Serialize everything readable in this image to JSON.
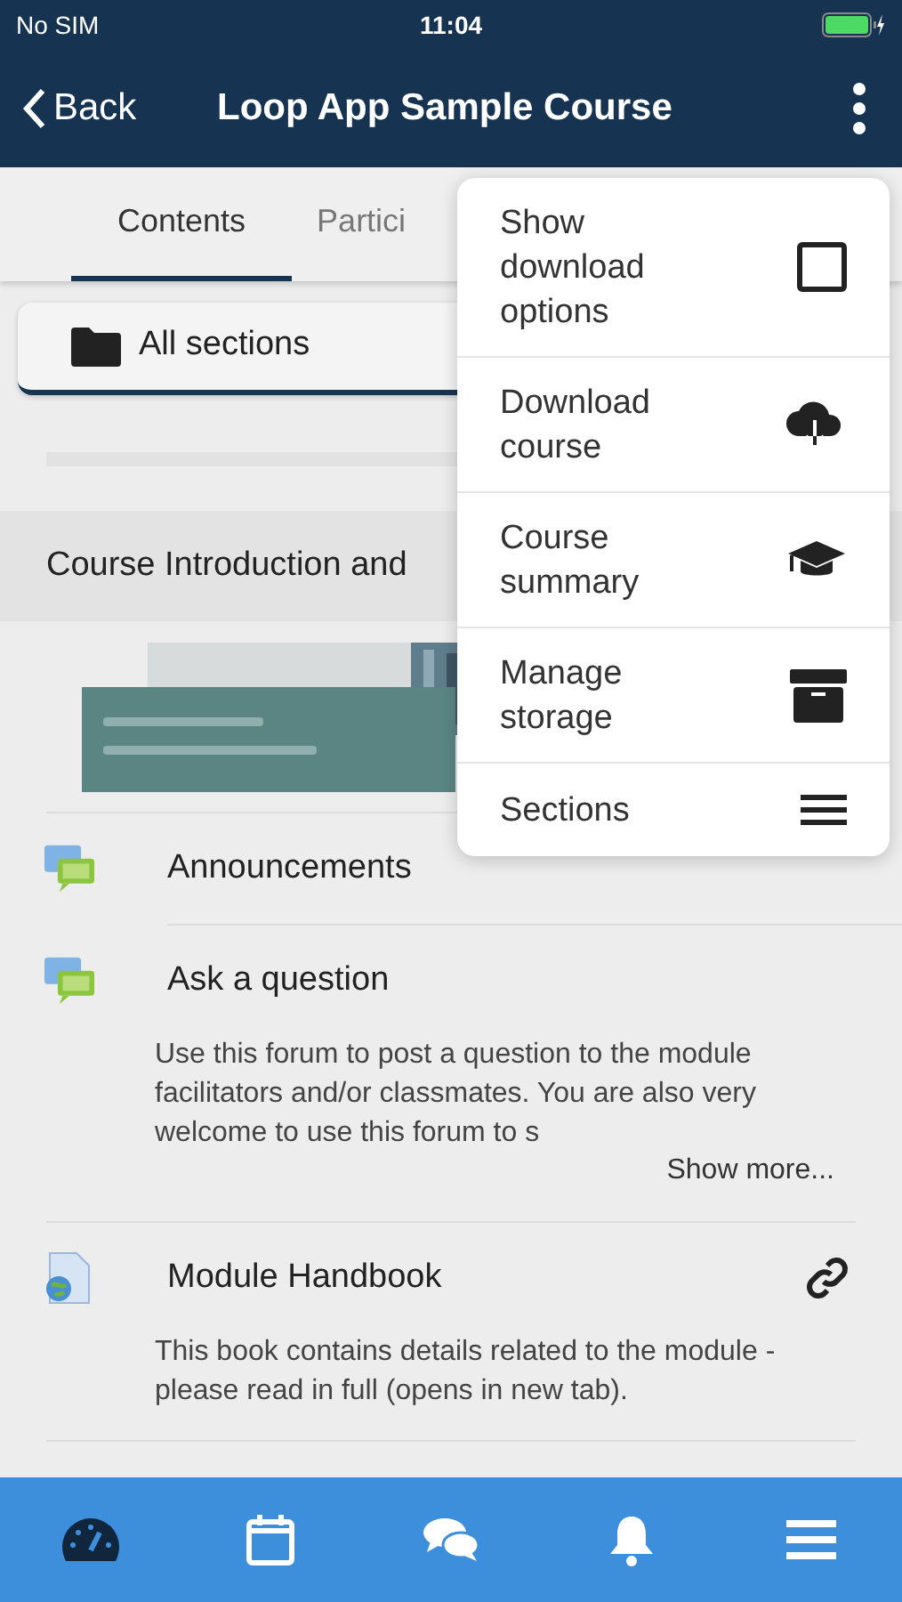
{
  "status_bar": {
    "carrier": "No SIM",
    "time": "11:04"
  },
  "nav_bar": {
    "back": "Back",
    "title": "Loop App Sample Course"
  },
  "tabs": [
    {
      "label": "Contents",
      "selected": true
    },
    {
      "label": "Partici",
      "selected": false
    }
  ],
  "section_selector": {
    "label": "All sections"
  },
  "section": {
    "title": "Course Introduction and"
  },
  "activities": [
    {
      "kind": "forum",
      "title": "Announcements"
    },
    {
      "kind": "forum",
      "title": "Ask a question",
      "description": "Use this forum to post a question to the module facilitators and/or classmates. You are also very welcome to use this forum to s",
      "show_more": "Show more..."
    },
    {
      "kind": "url",
      "title": "Module Handbook",
      "description": "This book contains details related to the module - please read in full (opens in new tab)."
    }
  ],
  "menu": [
    {
      "kind": "checkbox",
      "label": "Show download options",
      "checked": false
    },
    {
      "kind": "download",
      "label": "Download course"
    },
    {
      "kind": "summary",
      "label": "Course summary"
    },
    {
      "kind": "storage",
      "label": "Manage storage"
    },
    {
      "kind": "sections",
      "label": "Sections"
    }
  ],
  "bottom_nav": [
    {
      "kind": "dashboard",
      "selected": true
    },
    {
      "kind": "calendar",
      "selected": false
    },
    {
      "kind": "messages",
      "selected": false
    },
    {
      "kind": "notifications",
      "selected": false
    },
    {
      "kind": "more",
      "selected": false
    }
  ]
}
